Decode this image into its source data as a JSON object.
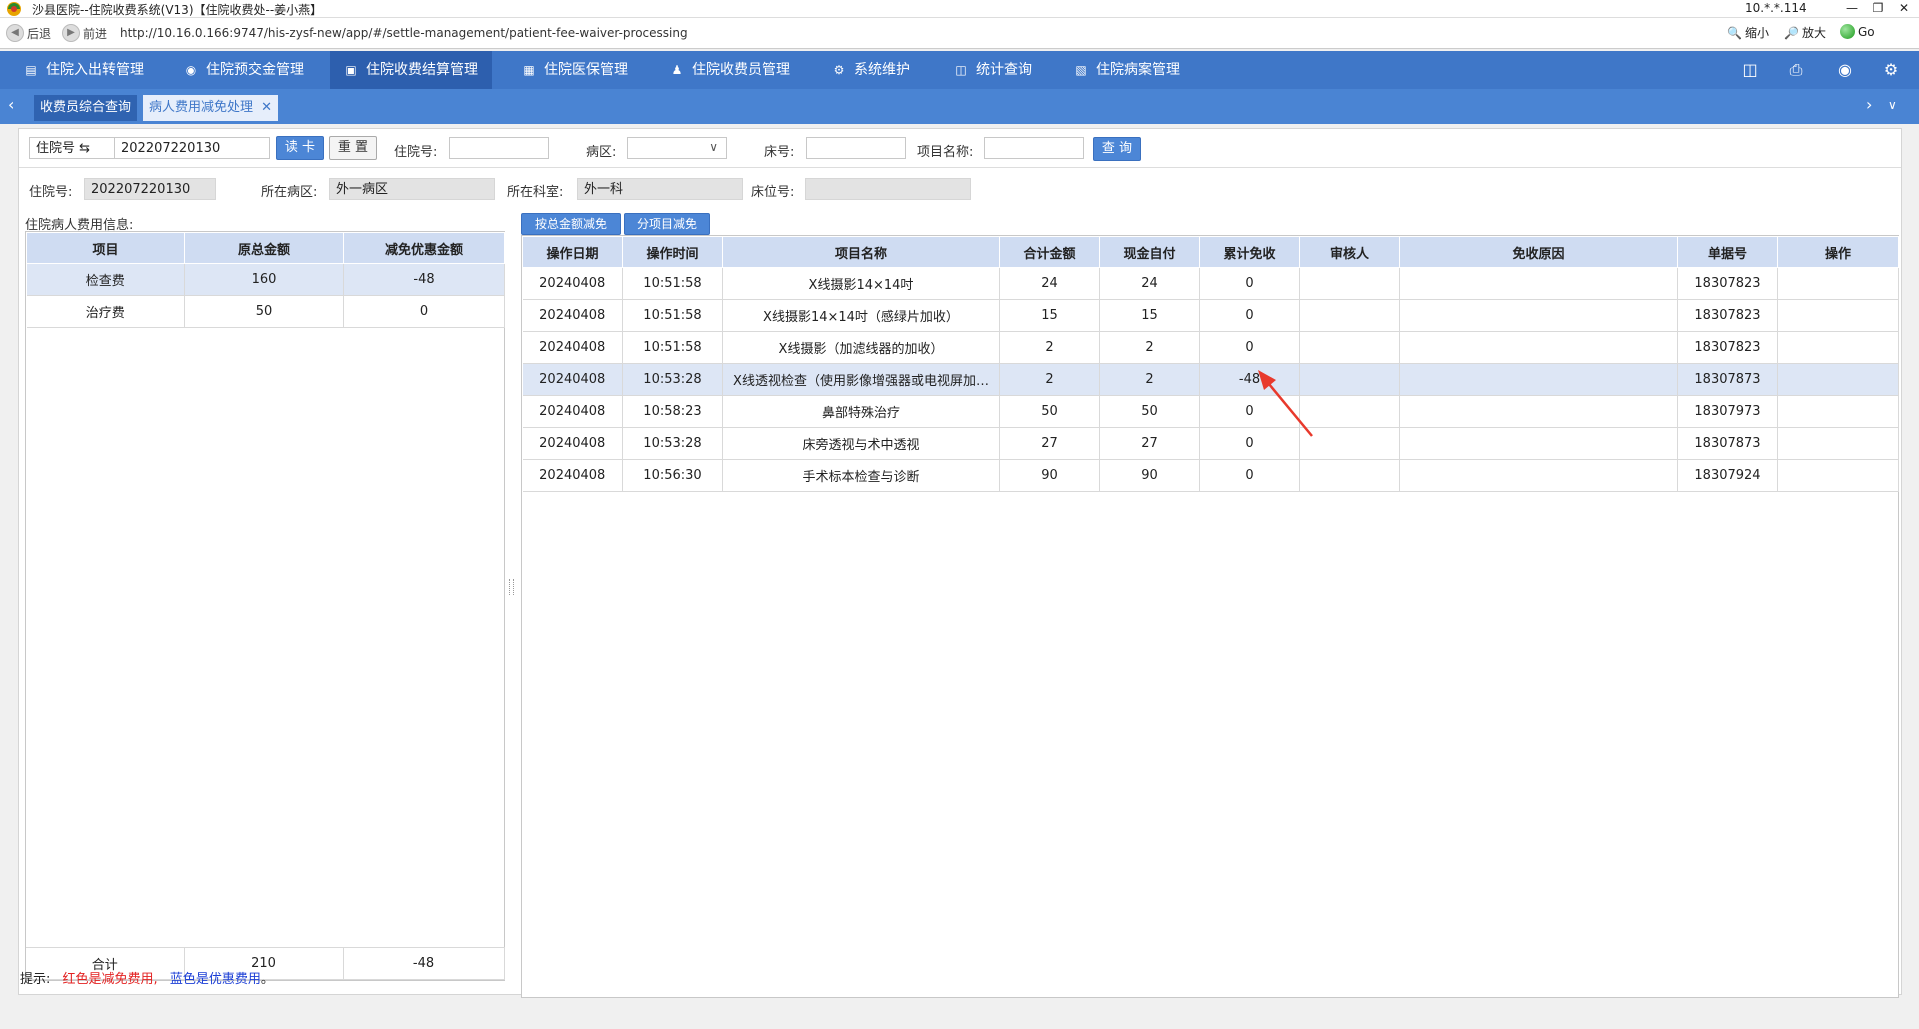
{
  "window": {
    "title": "沙县医院--住院收费系统(V13)【住院收费处--姜小燕】",
    "ip": "10.*.*.114"
  },
  "browser": {
    "back_label": "后退",
    "forward_label": "前进",
    "url": "http://10.16.0.166:9747/his-zysf-new/app/#/settle-management/patient-fee-waiver-processing",
    "zoom_out_label": "缩小",
    "zoom_in_label": "放大",
    "go_label": "Go"
  },
  "menu": [
    {
      "label": "住院入出转管理",
      "icon": "clipboard-icon"
    },
    {
      "label": "住院预交金管理",
      "icon": "target-icon"
    },
    {
      "label": "住院收费结算管理",
      "icon": "document-icon",
      "active": true
    },
    {
      "label": "住院医保管理",
      "icon": "card-icon"
    },
    {
      "label": "住院收费员管理",
      "icon": "user-icon"
    },
    {
      "label": "系统维护",
      "icon": "gear-icon"
    },
    {
      "label": "统计查询",
      "icon": "monitor-icon"
    },
    {
      "label": "住院病案管理",
      "icon": "book-icon"
    }
  ],
  "tabs": {
    "tab1": "收费员综合查询",
    "tab2": "病人费用减免处理"
  },
  "search": {
    "card_type_label": "住院号 ⇆",
    "card_value": "202207220130",
    "read_card_btn": "读 卡",
    "reset_btn": "重 置",
    "inpatient_no_label": "住院号:",
    "ward_label": "病区:",
    "bed_label": "床号:",
    "item_name_label": "项目名称:",
    "query_btn": "查 询"
  },
  "patient": {
    "inpatient_no_label": "住院号:",
    "inpatient_no": "202207220130",
    "ward_label": "所在病区:",
    "ward": "外一病区",
    "dept_label": "所在科室:",
    "dept": "外一科",
    "bed_label": "床位号:",
    "bed": ""
  },
  "left": {
    "title": "住院病人费用信息:",
    "headers": [
      "项目",
      "原总金额",
      "减免优惠金额"
    ],
    "rows": [
      [
        "检查费",
        "160",
        "-48"
      ],
      [
        "治疗费",
        "50",
        "0"
      ]
    ],
    "total": [
      "合计",
      "210",
      "-48"
    ]
  },
  "right": {
    "btn_total": "按总金额减免",
    "btn_item": "分项目减免",
    "headers": [
      "操作日期",
      "操作时间",
      "项目名称",
      "合计金额",
      "现金自付",
      "累计免收",
      "审核人",
      "免收原因",
      "单据号",
      "操作"
    ],
    "rows": [
      [
        "20240408",
        "10:51:58",
        "X线摄影14×14吋",
        "24",
        "24",
        "0",
        "",
        "",
        "18307823",
        ""
      ],
      [
        "20240408",
        "10:51:58",
        "X线摄影14×14吋（感绿片加收）",
        "15",
        "15",
        "0",
        "",
        "",
        "18307823",
        ""
      ],
      [
        "20240408",
        "10:51:58",
        "X线摄影（加滤线器的加收）",
        "2",
        "2",
        "0",
        "",
        "",
        "18307823",
        ""
      ],
      [
        "20240408",
        "10:53:28",
        "X线透视检查（使用影像增强器或电视屏加…",
        "2",
        "2",
        "-48",
        "",
        "",
        "18307873",
        ""
      ],
      [
        "20240408",
        "10:58:23",
        "鼻部特殊治疗",
        "50",
        "50",
        "0",
        "",
        "",
        "18307973",
        ""
      ],
      [
        "20240408",
        "10:53:28",
        "床旁透视与术中透视",
        "27",
        "27",
        "0",
        "",
        "",
        "18307873",
        ""
      ],
      [
        "20240408",
        "10:56:30",
        "手术标本检查与诊断",
        "90",
        "90",
        "0",
        "",
        "",
        "18307924",
        ""
      ]
    ]
  },
  "hint": {
    "prefix": "提示:",
    "red_text": "红色是减免费用,",
    "blue_text": "蓝色是优惠费用",
    "suffix": "。"
  },
  "colors": {
    "menu_bg": "#3f77c8",
    "tab_bg": "#4a84d3",
    "header_bg": "#cfdcf2",
    "selected_row": "#dde6f5",
    "arrow": "#e8392c"
  }
}
